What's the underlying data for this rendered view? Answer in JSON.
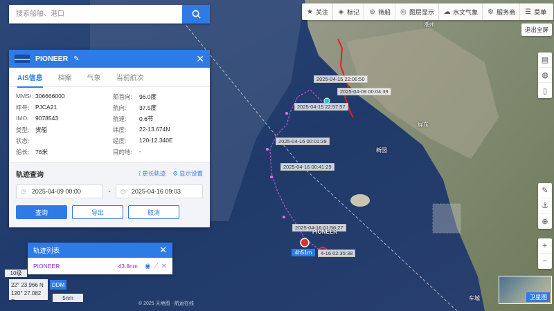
{
  "search": {
    "placeholder": "搜索船舶、港口"
  },
  "toolbar": {
    "items": [
      {
        "label": "关注",
        "icon": "star-icon"
      },
      {
        "label": "标记",
        "icon": "mark-icon"
      },
      {
        "label": "筛船",
        "icon": "filter-icon"
      },
      {
        "label": "图层显示",
        "icon": "layers-icon"
      },
      {
        "label": "水文气象",
        "icon": "weather-icon"
      },
      {
        "label": "服务商",
        "icon": "service-icon"
      },
      {
        "label": "菜单",
        "icon": "menu-icon"
      }
    ],
    "fullscreen": "退出全屏"
  },
  "panel": {
    "ship_name": "PIONEER",
    "tabs": [
      "AIS信息",
      "档案",
      "气象",
      "当前航次"
    ],
    "info_left": [
      {
        "label": "MMSI:",
        "value": "306666000"
      },
      {
        "label": "呼号:",
        "value": "PJCA21"
      },
      {
        "label": "IMO:",
        "value": "9078543"
      },
      {
        "label": "类型:",
        "value": "货船"
      },
      {
        "label": "状态:",
        "value": ""
      },
      {
        "label": "船长:",
        "value": "76米"
      }
    ],
    "info_right": [
      {
        "label": "船首向:",
        "value": "96.0度"
      },
      {
        "label": "航向:",
        "value": "37.5度"
      },
      {
        "label": "航速:",
        "value": "0.6节"
      },
      {
        "label": "纬度:",
        "value": "22-13.674N"
      },
      {
        "label": "经度:",
        "value": "120-12.340E"
      },
      {
        "label": "目的地:",
        "value": "-"
      }
    ],
    "track": {
      "title": "轨迹查询",
      "longer_link": "更长轨迹",
      "settings_link": "显示设置",
      "start": "2025-04-09 00:00",
      "separator": "-",
      "end": "2025-04-16 09:03",
      "query": "查询",
      "export": "导出",
      "cancel": "取消"
    }
  },
  "tracklist": {
    "title": "轨迹列表",
    "ship": "PIONEER",
    "distance": "43.8nm"
  },
  "status": {
    "zoom": "10级",
    "lat": "22° 23.966 N",
    "lon": "120° 27.082 E",
    "format": "DDM",
    "scale": "5nm"
  },
  "map": {
    "timestamps": [
      "2025-04-15 22:06:50",
      "2025-04-09 00:04:39",
      "2025-04-15 22:57:57",
      "2025-04-16 00:01:39",
      "2025-04-16 00:41:29",
      "2025-04-16 01:56:27",
      "4-16 02:35:38"
    ],
    "ship_label": "PIONEER",
    "duration": "4h51m",
    "towns": [
      "恒春",
      "新园",
      "屏东",
      "车城",
      "潮州"
    ],
    "satellite": "卫星图",
    "copyright": "© 2025 天地图 · 航运在线"
  }
}
